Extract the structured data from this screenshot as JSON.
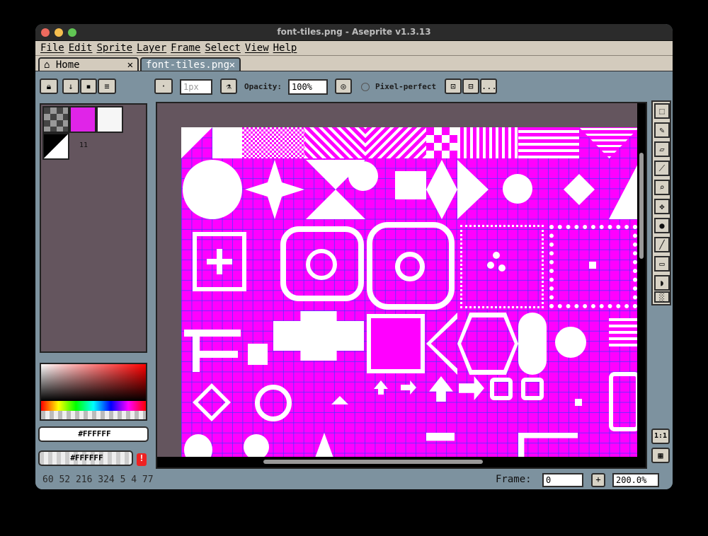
{
  "window": {
    "title": "font-tiles.png - Aseprite v1.3.13"
  },
  "menu": [
    "File",
    "Edit",
    "Sprite",
    "Layer",
    "Frame",
    "Select",
    "View",
    "Help"
  ],
  "tabs": [
    {
      "label": "Home",
      "close": "✕"
    },
    {
      "label": "font-tiles.png",
      "close": "✕"
    }
  ],
  "toolbar": {
    "brush_size": "1px",
    "opacity_label": "Opacity:",
    "opacity_value": "100%",
    "pixel_perfect_label": "Pixel-perfect",
    "more": "..."
  },
  "palette": {
    "index_label": "11"
  },
  "color": {
    "foreground_hex": "#FFFFFF",
    "background_hex": "#FFFFFF",
    "warning": "!"
  },
  "status": {
    "text": "60 52   216 324   5 4   77",
    "frame_label": "Frame:",
    "frame_value": "0",
    "zoom_value": "200.0%",
    "add_frame": "+"
  },
  "tools": [
    "marquee-icon",
    "pencil-icon",
    "eraser-icon",
    "eyedropper-icon",
    "zoom-icon",
    "move-icon",
    "fill-icon",
    "line-icon",
    "rectangle-icon",
    "blob-icon",
    "blur-icon"
  ],
  "right_bottom": {
    "ratio": "1:1"
  }
}
